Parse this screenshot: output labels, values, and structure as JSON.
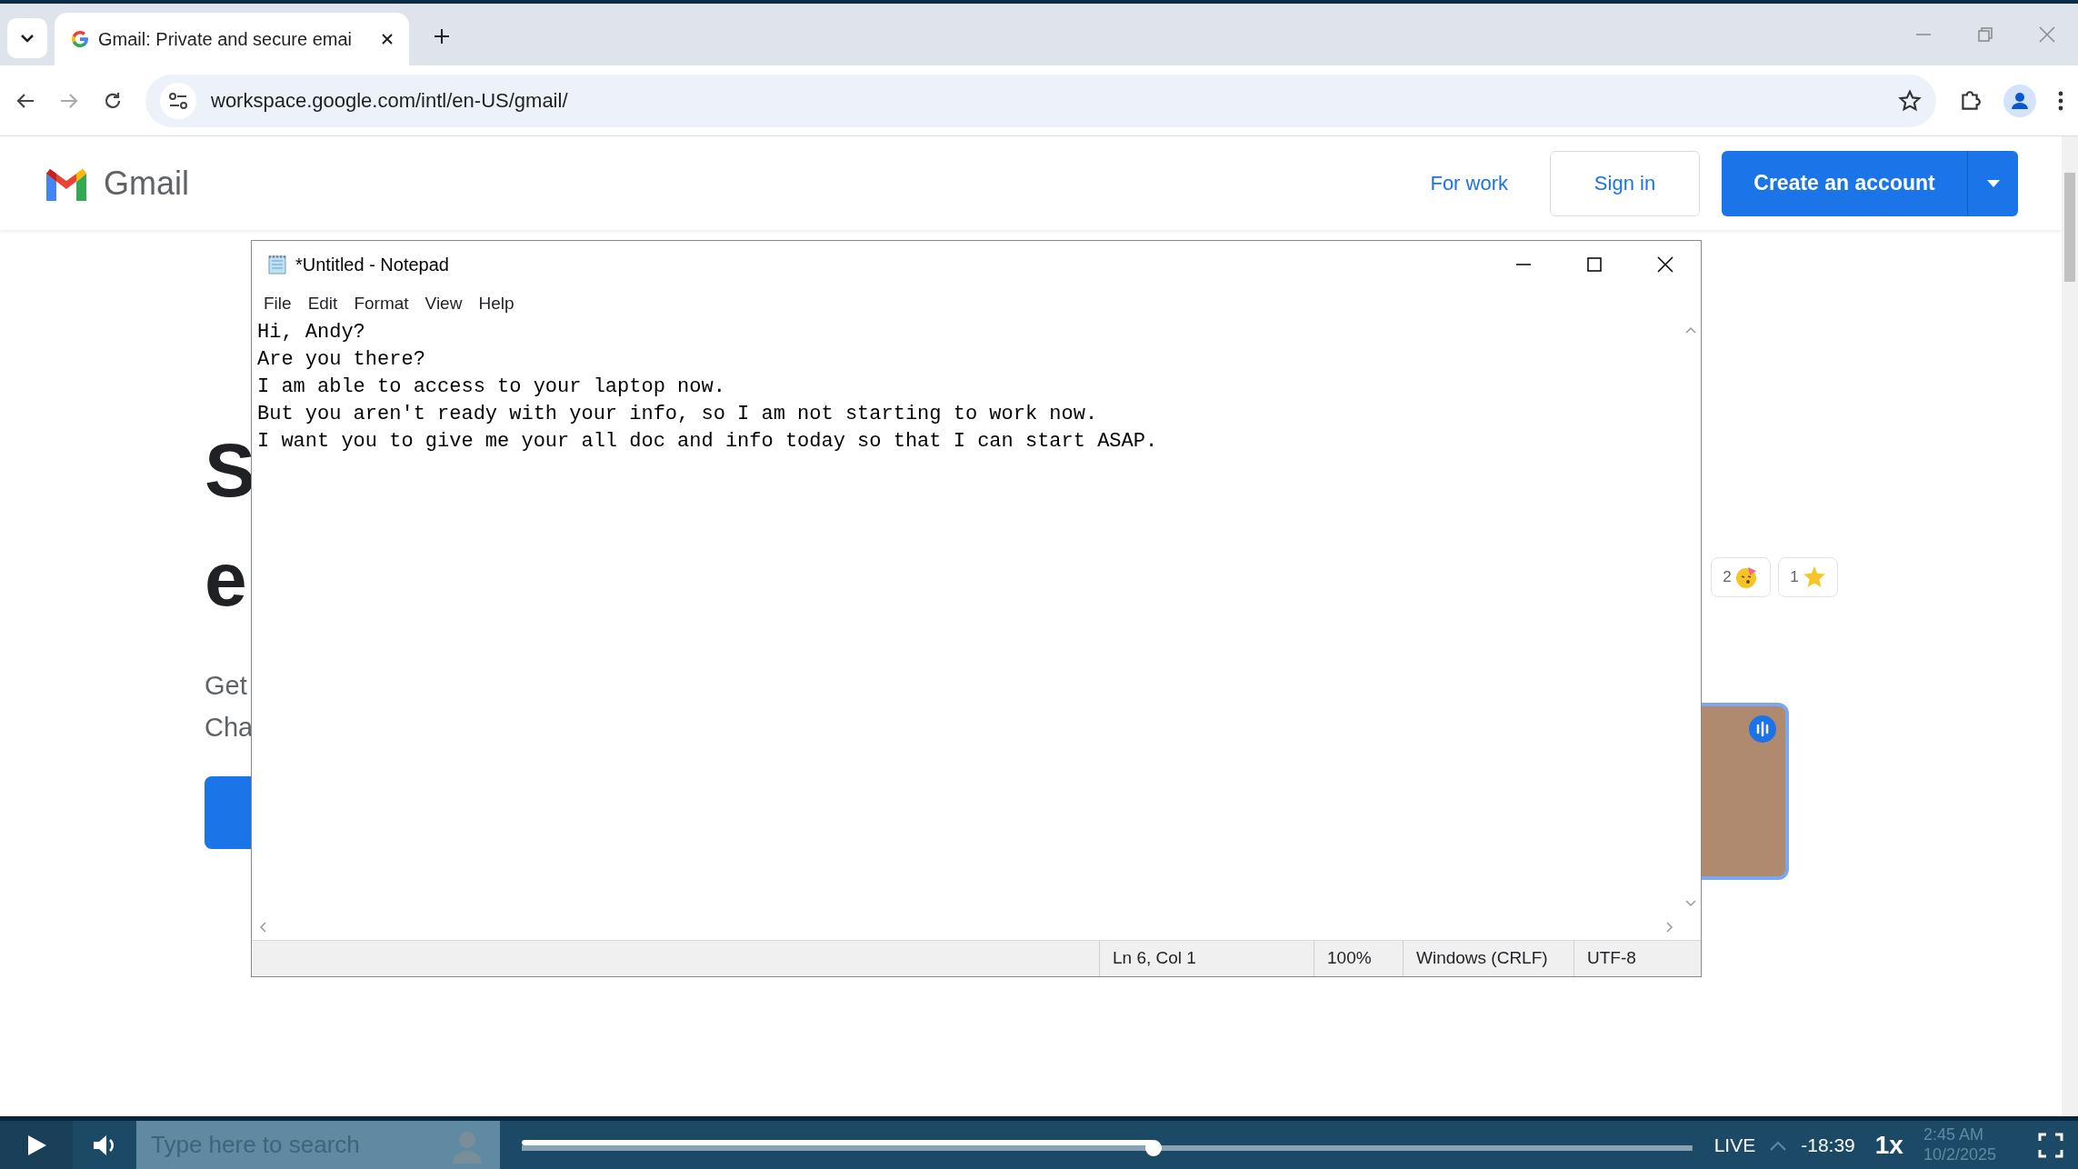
{
  "browser": {
    "tabs": [
      {
        "title": "Gmail: Private and secure emai",
        "selected": true
      }
    ],
    "address": "workspace.google.com/intl/en-US/gmail/"
  },
  "page": {
    "logo_text": "Gmail",
    "nav": [
      {
        "label": "For work",
        "kind": "link"
      },
      {
        "label": "Sign in",
        "kind": "outline"
      },
      {
        "label": "Create an account",
        "kind": "primary"
      }
    ],
    "heading_fragments": [
      "S",
      "e"
    ],
    "subtitle_fragments": [
      "Get",
      "Cha"
    ],
    "reactions": [
      {
        "count": "2",
        "kind": "party"
      },
      {
        "count": "1",
        "kind": "star"
      }
    ]
  },
  "notepad": {
    "title": "*Untitled - Notepad",
    "menu": [
      "File",
      "Edit",
      "Format",
      "View",
      "Help"
    ],
    "lines": [
      "Hi, Andy?",
      "Are you there?",
      "I am able to access to your laptop now.",
      "But you aren't ready with your info, so I am not starting to work now.",
      "I want you to give me your all doc and info today so that I can start ASAP."
    ],
    "status": [
      "Ln 6, Col 1",
      "100%",
      "Windows (CRLF)",
      "UTF-8"
    ]
  },
  "taskbar": {
    "search_placeholder": "Type here to search",
    "time": "2:45 AM",
    "date": "10/2/2025"
  },
  "player": {
    "level": 0.54,
    "live": "LIVE",
    "remaining": "-18:39",
    "speed": "1x"
  }
}
